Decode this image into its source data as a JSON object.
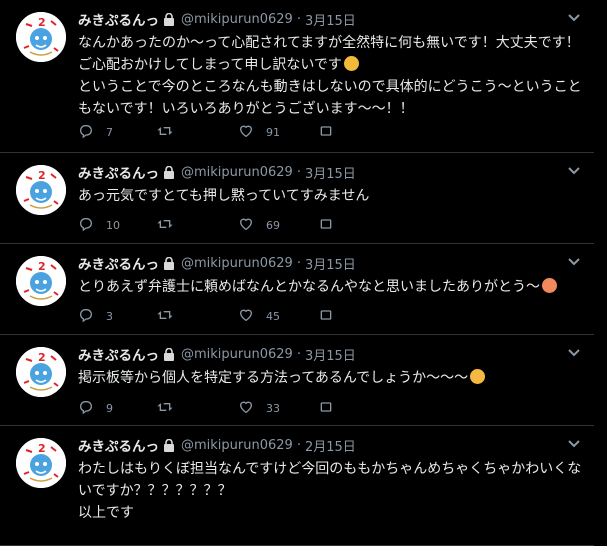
{
  "user": {
    "name": "みきぷるんっ",
    "handle": "@mikipurun0629",
    "separator": "·"
  },
  "tweets": [
    {
      "date": "3月15日",
      "lines": [
        "なんかあったのか〜って心配されてますが全然特に何も無いです！大丈夫です！",
        "ご心配おかけしてしまって申し訳ないです",
        "ということで今のところなんも動きはしないので具体的にどうこう〜ということ",
        "もないです！いろいろありがとうございます〜〜！！"
      ],
      "emoji_line": 1,
      "emoji": "crying-face-emoji",
      "reply_count": "7",
      "like_count": "91"
    },
    {
      "date": "3月15日",
      "lines": [
        "あっ元気ですとても押し黙っていてすみません"
      ],
      "reply_count": "10",
      "like_count": "69"
    },
    {
      "date": "3月15日",
      "lines": [
        "とりあえず弁護士に頼めばなんとかなるんやなと思いましたありがとう〜"
      ],
      "emoji_line": 0,
      "emoji": "smiling-face-emoji",
      "reply_count": "3",
      "like_count": "45"
    },
    {
      "date": "3月15日",
      "lines": [
        "掲示板等から個人を特定する方法ってあるんでしょうか〜〜〜"
      ],
      "emoji_line": 0,
      "emoji": "thinking-face-emoji",
      "reply_count": "9",
      "like_count": "33"
    },
    {
      "date": "2月15日",
      "lines": [
        "わたしはもりくぼ担当なんですけど今回のももかちゃんめちゃくちゃかわいくな",
        "いですか？？？？？？？",
        "以上です"
      ],
      "reply_count": "",
      "like_count": ""
    }
  ],
  "colors": {
    "background": "#000000",
    "text": "#e7e9ea",
    "muted": "#8b98a5",
    "divider": "#2f3336"
  }
}
